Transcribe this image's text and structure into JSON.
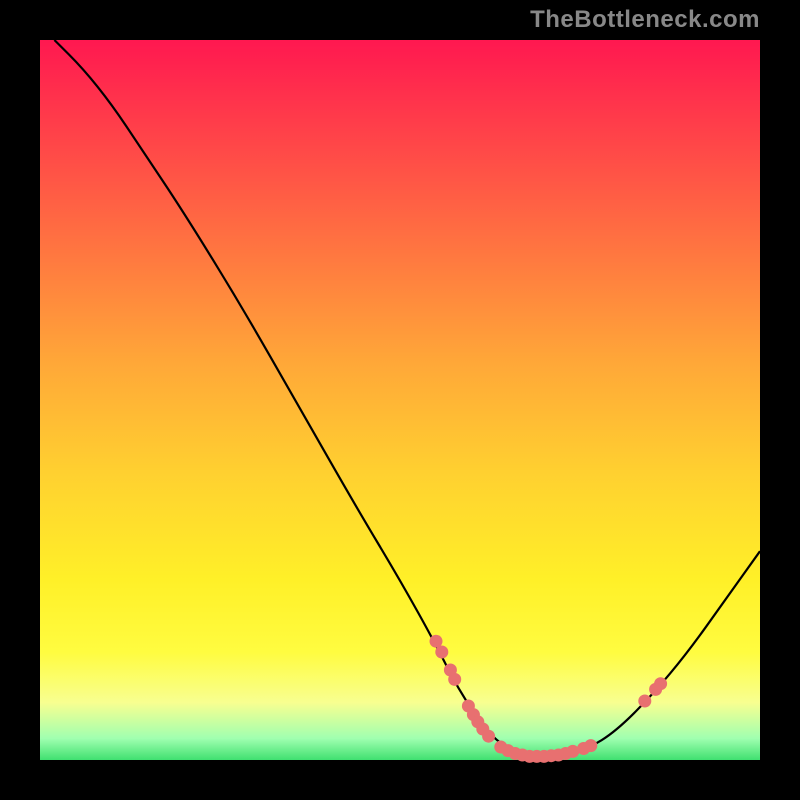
{
  "attribution": "TheBottleneck.com",
  "chart_data": {
    "type": "line",
    "title": "",
    "xlabel": "",
    "ylabel": "",
    "xlim": [
      0,
      100
    ],
    "ylim": [
      0,
      100
    ],
    "curve": [
      {
        "x": 2,
        "y": 100
      },
      {
        "x": 6,
        "y": 96
      },
      {
        "x": 10,
        "y": 91
      },
      {
        "x": 14,
        "y": 85
      },
      {
        "x": 20,
        "y": 76
      },
      {
        "x": 28,
        "y": 63
      },
      {
        "x": 36,
        "y": 49
      },
      {
        "x": 44,
        "y": 35
      },
      {
        "x": 50,
        "y": 25
      },
      {
        "x": 55,
        "y": 16
      },
      {
        "x": 58,
        "y": 10
      },
      {
        "x": 62,
        "y": 4
      },
      {
        "x": 65,
        "y": 1.5
      },
      {
        "x": 68,
        "y": 0.5
      },
      {
        "x": 72,
        "y": 0.5
      },
      {
        "x": 76,
        "y": 1.5
      },
      {
        "x": 80,
        "y": 4
      },
      {
        "x": 85,
        "y": 9
      },
      {
        "x": 90,
        "y": 15
      },
      {
        "x": 95,
        "y": 22
      },
      {
        "x": 100,
        "y": 29
      }
    ],
    "markers": [
      {
        "x": 55,
        "y": 16.5
      },
      {
        "x": 55.8,
        "y": 15
      },
      {
        "x": 57,
        "y": 12.5
      },
      {
        "x": 57.6,
        "y": 11.2
      },
      {
        "x": 59.5,
        "y": 7.5
      },
      {
        "x": 60.2,
        "y": 6.3
      },
      {
        "x": 60.8,
        "y": 5.3
      },
      {
        "x": 61.5,
        "y": 4.3
      },
      {
        "x": 62.3,
        "y": 3.3
      },
      {
        "x": 64,
        "y": 1.8
      },
      {
        "x": 65,
        "y": 1.3
      },
      {
        "x": 66,
        "y": 0.9
      },
      {
        "x": 67,
        "y": 0.7
      },
      {
        "x": 68,
        "y": 0.5
      },
      {
        "x": 69,
        "y": 0.5
      },
      {
        "x": 70,
        "y": 0.5
      },
      {
        "x": 71,
        "y": 0.6
      },
      {
        "x": 72,
        "y": 0.7
      },
      {
        "x": 73,
        "y": 0.9
      },
      {
        "x": 74,
        "y": 1.2
      },
      {
        "x": 75.5,
        "y": 1.6
      },
      {
        "x": 76.5,
        "y": 2.0
      },
      {
        "x": 84,
        "y": 8.2
      },
      {
        "x": 85.5,
        "y": 9.8
      },
      {
        "x": 86.2,
        "y": 10.6
      }
    ]
  }
}
